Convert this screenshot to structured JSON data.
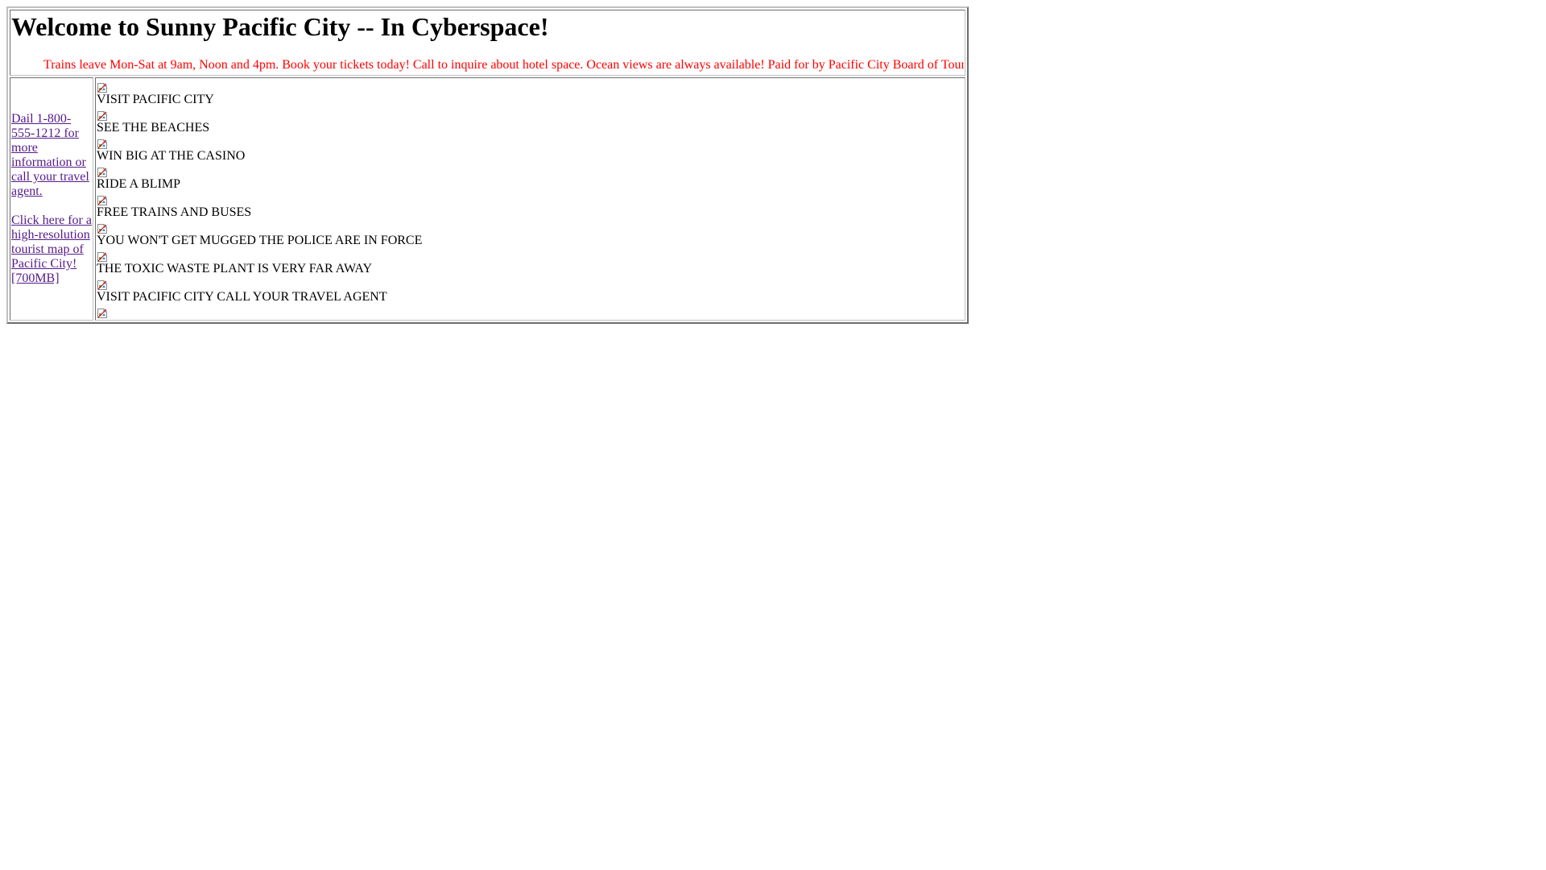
{
  "header": {
    "title": "Welcome to Sunny Pacific City -- In Cyberspace!",
    "marquee": "Trains leave Mon-Sat at 9am, Noon and 4pm. Book your tickets today! Call to inquire about hotel space. Ocean views are always available! Paid for by Pacific City Board of Tourism."
  },
  "sidebar": {
    "phone_link": "Dail 1-800-555-1212 for more information or call your travel agent.",
    "map_link": "Click here for a high-resolution tourist map of Pacific City! [700MB]"
  },
  "main": {
    "items": [
      {
        "text": "VISIT PACIFIC CITY",
        "icon": "broken-image-icon"
      },
      {
        "text": "SEE THE BEACHES",
        "icon": "broken-image-icon"
      },
      {
        "text": "WIN BIG AT THE CASINO",
        "icon": "broken-image-icon"
      },
      {
        "text": "RIDE A BLIMP",
        "icon": "broken-image-icon"
      },
      {
        "text": "FREE TRAINS AND BUSES",
        "icon": "broken-image-icon"
      },
      {
        "text": "YOU WON'T GET MUGGED THE POLICE ARE IN FORCE",
        "icon": "broken-image-icon"
      },
      {
        "text": "THE TOXIC WASTE PLANT IS VERY FAR AWAY",
        "icon": "broken-image-icon"
      },
      {
        "text": "VISIT PACIFIC CITY CALL YOUR TRAVEL AGENT",
        "icon": "broken-image-icon"
      }
    ],
    "trailing_icon": "broken-image-icon"
  },
  "colors": {
    "marquee": "#ff0000",
    "visited_link": "#551a8b"
  }
}
